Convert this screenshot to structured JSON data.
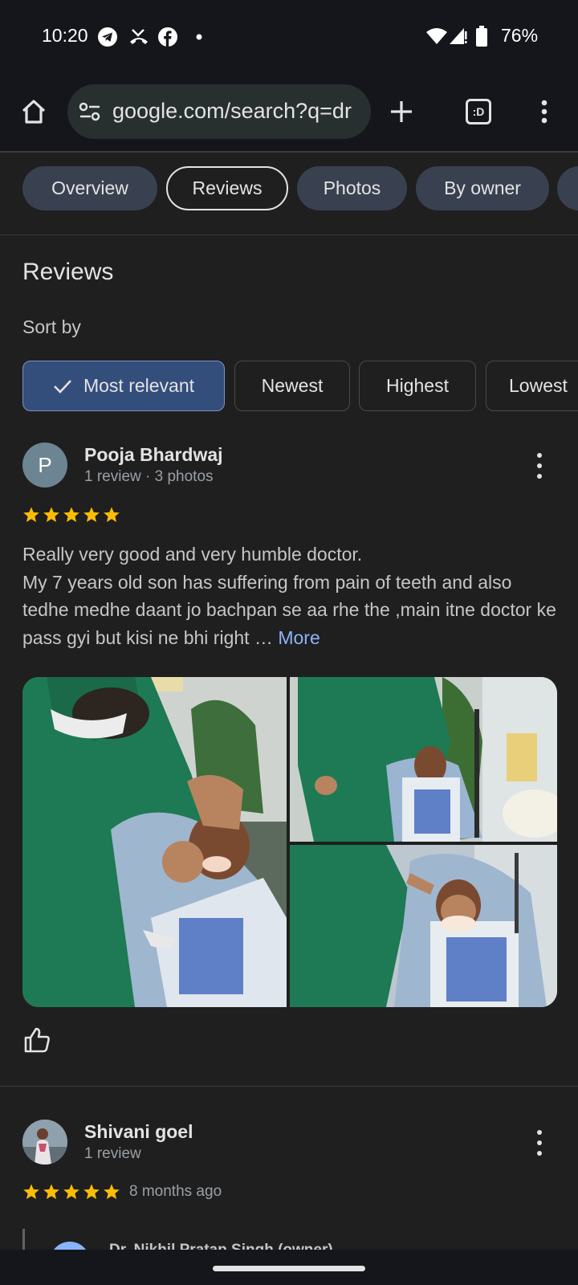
{
  "status_bar": {
    "time": "10:20",
    "battery": "76%",
    "icons": [
      "telegram-icon",
      "missed-call-icon",
      "facebook-icon",
      "dot-icon",
      "wifi-icon",
      "signal-icon",
      "battery-icon"
    ]
  },
  "browser": {
    "url": "google.com/search?q=dr",
    "tab_count_icon": ":D"
  },
  "tabs": [
    "Overview",
    "Reviews",
    "Photos",
    "By owner"
  ],
  "active_tab": "Reviews",
  "reviews_title": "Reviews",
  "sort_by_label": "Sort by",
  "sort_chips": [
    "Most relevant",
    "Newest",
    "Highest",
    "Lowest"
  ],
  "selected_sort": "Most relevant",
  "reviews": [
    {
      "avatar_letter": "P",
      "name": "Pooja Bhardwaj",
      "meta": "1 review · 3 photos",
      "rating": 5,
      "text": "Really very good and very humble doctor.\nMy 7 years old son has suffering from pain of teeth and also tedhe medhe daant jo bachpan se aa rhe the ,main itne doctor ke pass gyi but kisi ne bhi right … ",
      "more_label": "More",
      "photo_count": 3
    },
    {
      "name": "Shivani goel",
      "meta": "1 review",
      "rating": 5,
      "time_ago": "8 months ago",
      "owner_reply_name": "Dr. Nikhil Pratap Singh (owner)"
    }
  ],
  "colors": {
    "background": "#1f1f1f",
    "chrome": "#15161c",
    "star": "#fbbc04",
    "link": "#8ab4f8",
    "selected_chip": "#344e7c"
  }
}
